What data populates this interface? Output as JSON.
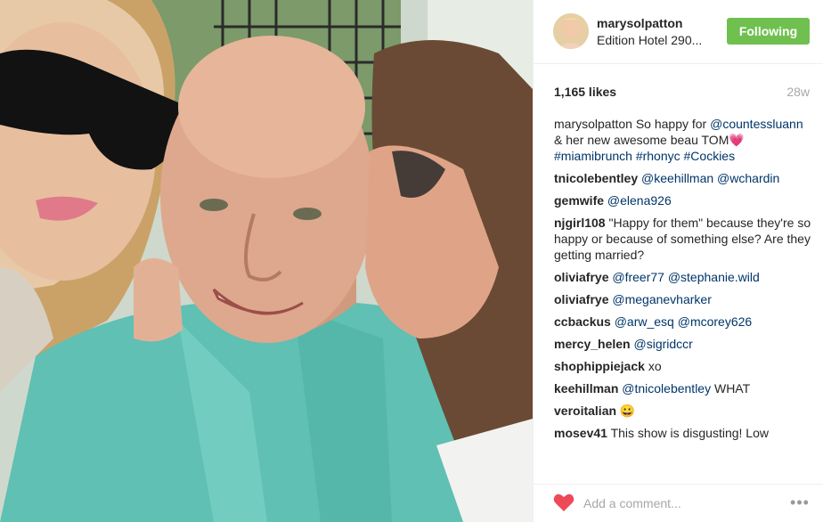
{
  "post": {
    "username": "marysolpatton",
    "location": "Edition Hotel 290...",
    "follow_label": "Following",
    "likes": "1,165 likes",
    "age": "28w",
    "caption": {
      "username": "marysolpatton",
      "text_1": "So happy for",
      "mention": "@countessluann",
      "text_2": "& her new awesome beau TOM",
      "emoji": "💗",
      "tags": "#miamibrunch #rhonyc #Cockies"
    },
    "comments": [
      {
        "user": "tnicolebentley",
        "text": "",
        "mentions": "@keehillman @wchardin"
      },
      {
        "user": "gemwife",
        "text": "",
        "mentions": "@elena926"
      },
      {
        "user": "njgirl108",
        "text": "\"Happy for them\" because they're so happy or because of something else? Are they getting married?",
        "mentions": ""
      },
      {
        "user": "oliviafrye",
        "text": "",
        "mentions": "@freer77 @stephanie.wild"
      },
      {
        "user": "oliviafrye",
        "text": "",
        "mentions": "@meganevharker"
      },
      {
        "user": "ccbackus",
        "text": "",
        "mentions": "@arw_esq @mcorey626"
      },
      {
        "user": "mercy_helen",
        "text": "",
        "mentions": "@sigridccr"
      },
      {
        "user": "shophippiejack",
        "text": "xo",
        "mentions": ""
      },
      {
        "user": "keehillman",
        "text": "WHAT",
        "mentions": "@tnicolebentley"
      },
      {
        "user": "veroitalian",
        "text": "😀",
        "mentions": ""
      },
      {
        "user": "mosev41",
        "text": "This show is disgusting! Low",
        "mentions": ""
      }
    ],
    "add_comment_placeholder": "Add a comment...",
    "more_label": "•••"
  },
  "colors": {
    "follow_green": "#70c050",
    "mention_blue": "#003569",
    "heart_red": "#ed4956",
    "muted_gray": "#a5a7aa"
  }
}
